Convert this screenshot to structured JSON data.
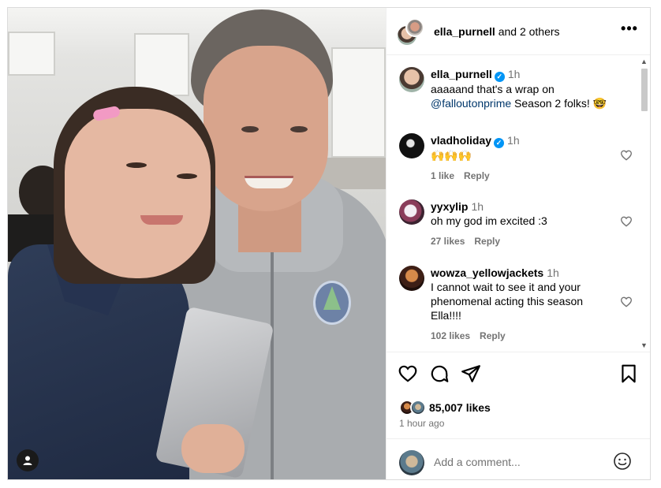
{
  "post": {
    "author": "ella_purnell",
    "coauthors_text": "and 2 others",
    "more_label": "•••"
  },
  "comments": [
    {
      "username": "ella_purnell",
      "verified": true,
      "time": "1h",
      "text_before": "aaaaand that's a wrap on",
      "mention": "@falloutonprime",
      "text_after": "Season 2 folks! 🤓"
    },
    {
      "username": "vladholiday",
      "verified": true,
      "time": "1h",
      "text": "🙌🙌🙌",
      "likes": "1 like",
      "reply": "Reply"
    },
    {
      "username": "yyxylip",
      "verified": false,
      "time": "1h",
      "text": "oh my god im excited :3",
      "likes": "27 likes",
      "reply": "Reply"
    },
    {
      "username": "wowza_yellowjackets",
      "verified": false,
      "time": "1h",
      "text": "I cannot wait to see it and your phenomenal acting this season Ella!!!!",
      "likes": "102 likes",
      "reply": "Reply"
    }
  ],
  "stats": {
    "likes": "85,007 likes",
    "posted": "1 hour ago"
  },
  "composer": {
    "placeholder": "Add a comment..."
  },
  "icons": {
    "like": "heart-icon",
    "comment": "comment-icon",
    "share": "share-icon",
    "save": "bookmark-icon",
    "emoji": "emoji-icon",
    "tag": "user-tag-icon",
    "verified": "verified-badge-icon"
  },
  "colors": {
    "verified": "#0095f6",
    "mention": "#00376b",
    "secondary_text": "#737373",
    "border": "#dbdbdb"
  }
}
